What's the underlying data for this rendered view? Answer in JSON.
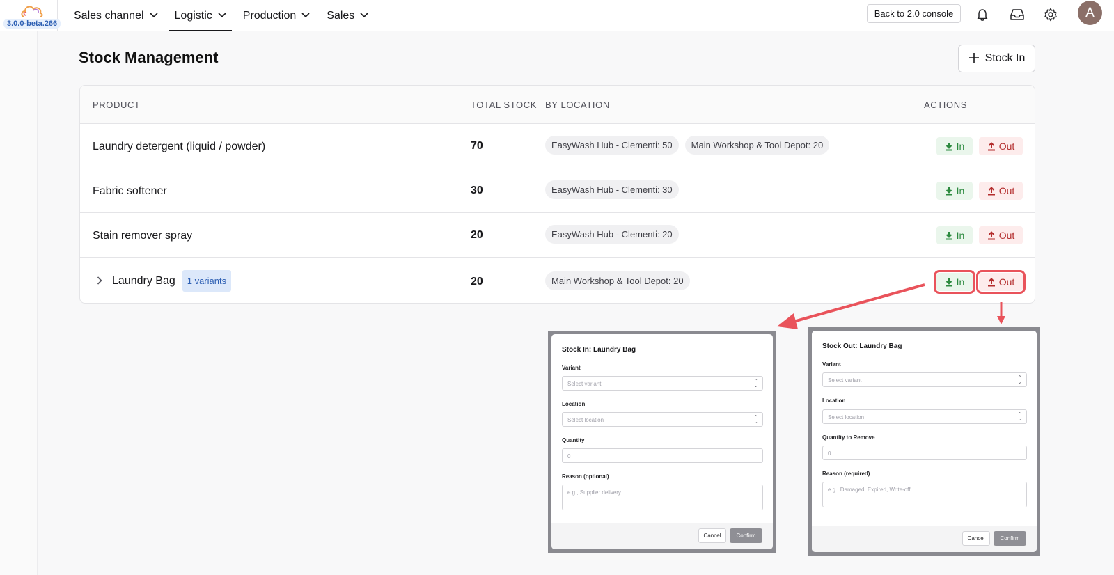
{
  "header": {
    "version": "3.0.0-beta.266",
    "nav": [
      {
        "label": "Sales channel"
      },
      {
        "label": "Logistic"
      },
      {
        "label": "Production"
      },
      {
        "label": "Sales"
      }
    ],
    "back_button": "Back to 2.0 console",
    "avatar_initial": "A",
    "icons": {
      "bell": "bell-icon",
      "inbox": "inbox-icon",
      "settings": "gear-icon"
    }
  },
  "page": {
    "title": "Stock Management",
    "stock_in_button": "Stock In"
  },
  "table": {
    "columns": {
      "product": "PRODUCT",
      "total": "TOTAL STOCK",
      "location": "BY LOCATION",
      "actions": "ACTIONS"
    },
    "rows": [
      {
        "name": "Laundry detergent (liquid / powder)",
        "total": "70",
        "locations": [
          "EasyWash Hub - Clementi: 50",
          "Main Workshop & Tool Depot: 20"
        ]
      },
      {
        "name": "Fabric softener",
        "total": "30",
        "locations": [
          "EasyWash Hub - Clementi: 30"
        ]
      },
      {
        "name": "Stain remover spray",
        "total": "20",
        "locations": [
          "EasyWash Hub - Clementi: 20"
        ]
      },
      {
        "name": "Laundry Bag",
        "variants_badge": "1 variants",
        "total": "20",
        "locations": [
          "Main Workshop & Tool Depot: 20"
        ]
      }
    ],
    "action_in": "In",
    "action_out": "Out"
  },
  "dialogs": {
    "stock_in": {
      "title": "Stock In: Laundry Bag",
      "variant_label": "Variant",
      "variant_placeholder": "Select variant",
      "location_label": "Location",
      "location_placeholder": "Select location",
      "quantity_label": "Quantity",
      "quantity_placeholder": "0",
      "reason_label": "Reason (optional)",
      "reason_placeholder": "e.g., Supplier delivery",
      "cancel": "Cancel",
      "confirm": "Confirm"
    },
    "stock_out": {
      "title": "Stock Out: Laundry Bag",
      "variant_label": "Variant",
      "variant_placeholder": "Select variant",
      "location_label": "Location",
      "location_placeholder": "Select location",
      "quantity_label": "Quantity to Remove",
      "quantity_placeholder": "0",
      "reason_label": "Reason (required)",
      "reason_placeholder": "e.g., Damaged, Expired, Write-off",
      "cancel": "Cancel",
      "confirm": "Confirm"
    }
  },
  "colors": {
    "accent_green": "#2c8a3f",
    "accent_red": "#b42e2e",
    "annotation_red": "#e9535b",
    "badge_blue": "#2d5fb3"
  }
}
